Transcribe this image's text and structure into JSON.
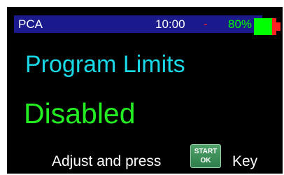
{
  "status_bar": {
    "title": "PCA",
    "time": "10:00",
    "separator": "-",
    "battery_percent_label": "80%",
    "battery_level": 0.8
  },
  "screen": {
    "heading": "Program Limits",
    "value": "Disabled"
  },
  "prompt": {
    "before": "Adjust and press",
    "key_line1": "START",
    "key_line2": "OK",
    "after": "Key",
    "key_icon": "start-ok-key-icon"
  },
  "colors": {
    "background": "#000000",
    "status_bar": "#1a1a8c",
    "heading": "#19d9e6",
    "value": "#22ee22",
    "battery_full": "#00ff00",
    "battery_empty": "#ff2020",
    "key": "#3a8d57"
  }
}
